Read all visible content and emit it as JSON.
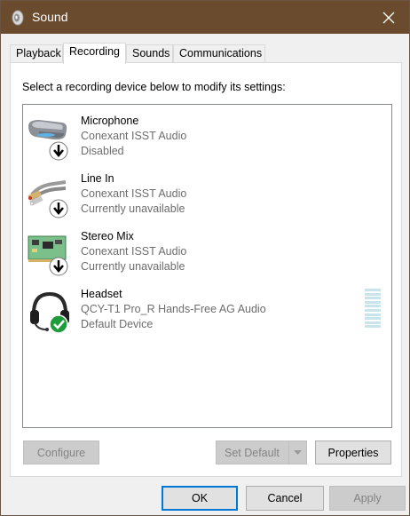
{
  "window": {
    "title": "Sound"
  },
  "tabs": [
    {
      "label": "Playback"
    },
    {
      "label": "Recording"
    },
    {
      "label": "Sounds"
    },
    {
      "label": "Communications"
    }
  ],
  "instructions": "Select a recording device below to modify its settings:",
  "devices": [
    {
      "name": "Microphone",
      "driver": "Conexant ISST Audio",
      "status": "Disabled",
      "icon": "microphone-icon"
    },
    {
      "name": "Line In",
      "driver": "Conexant ISST Audio",
      "status": "Currently unavailable",
      "icon": "line-in-jack-icon"
    },
    {
      "name": "Stereo Mix",
      "driver": "Conexant ISST Audio",
      "status": "Currently unavailable",
      "icon": "sound-card-icon"
    },
    {
      "name": "Headset",
      "driver": "QCY-T1 Pro_R Hands-Free AG Audio",
      "status": "Default Device",
      "icon": "headset-icon"
    }
  ],
  "buttons": {
    "configure": "Configure",
    "set_default": "Set Default",
    "properties": "Properties",
    "ok": "OK",
    "cancel": "Cancel",
    "apply": "Apply"
  },
  "colors": {
    "titlebar": "#6a4b2e",
    "default_check": "#1e9c3c",
    "accent": "#0078d7"
  }
}
